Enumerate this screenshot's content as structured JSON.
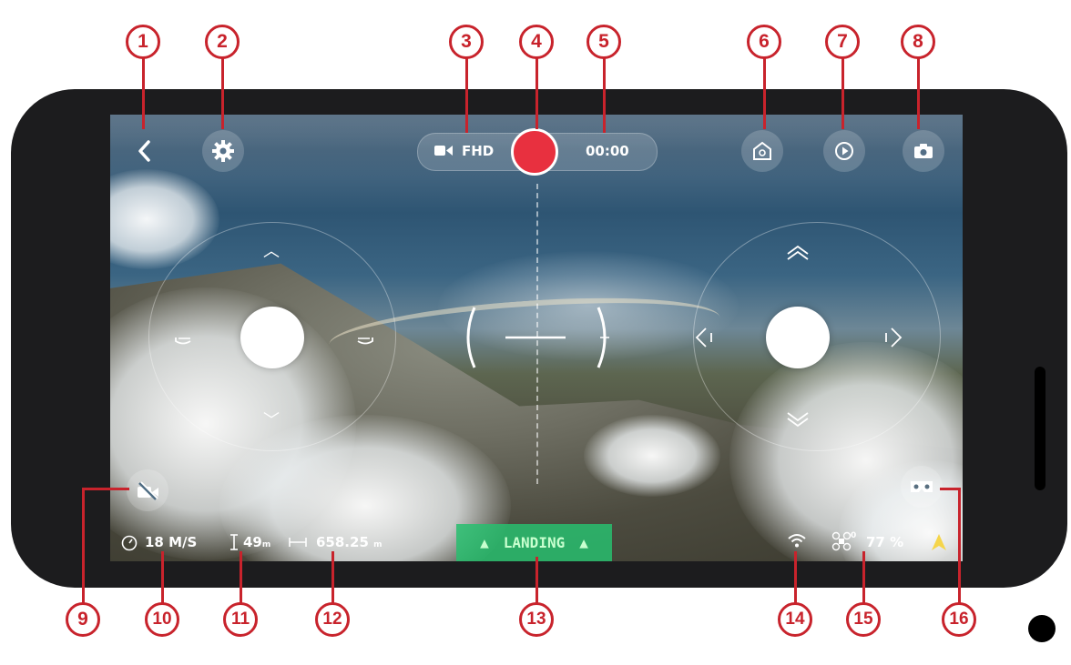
{
  "callouts": [
    "1",
    "2",
    "3",
    "4",
    "5",
    "6",
    "7",
    "8",
    "9",
    "10",
    "11",
    "12",
    "13",
    "14",
    "15",
    "16"
  ],
  "camera": {
    "resolution": "FHD",
    "timer": "00:00"
  },
  "telemetry": {
    "speed": "18 M/S",
    "altitude_value": "49",
    "altitude_unit": "m",
    "distance_value": "658.25",
    "distance_unit": "m",
    "battery": "77 %",
    "satellites": "0"
  },
  "landing": {
    "label": "LANDING"
  },
  "colors": {
    "record": "#e8303f",
    "callout": "#c8232c",
    "landing": "#28be6e",
    "compass": "#f5d54a"
  },
  "icons": [
    "back-icon",
    "gear-icon",
    "video-camera-icon",
    "record-icon",
    "home-point-icon",
    "playback-icon",
    "camera-icon",
    "camera-off-icon",
    "speedometer-icon",
    "altitude-icon",
    "distance-icon",
    "wifi-icon",
    "drone-icon",
    "vr-goggles-icon",
    "compass-icon"
  ]
}
